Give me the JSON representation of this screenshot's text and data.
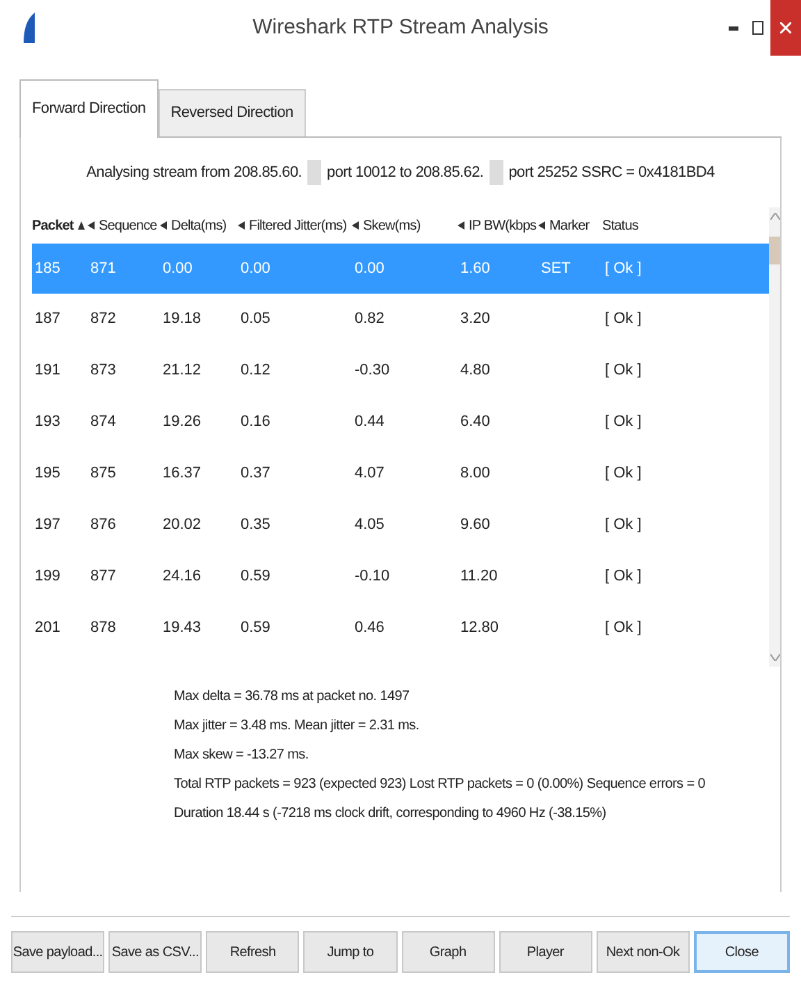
{
  "window": {
    "title": "Wireshark RTP Stream Analysis"
  },
  "tabs": [
    {
      "label": "Forward Direction",
      "selected": true
    },
    {
      "label": "Reversed Direction",
      "selected": false
    }
  ],
  "stream_info": {
    "prefix": "Analysing stream from  208.85.60.",
    "mid": "port 10012  to  208.85.62.",
    "suffix": "port 25252  SSRC = 0x4181BD4"
  },
  "table": {
    "columns": [
      {
        "label": "Packet",
        "sorted": true
      },
      {
        "label": "Sequence",
        "sorted": false
      },
      {
        "label": "Delta(ms)",
        "sorted": false
      },
      {
        "label": "Filtered Jitter(ms)",
        "sorted": false
      },
      {
        "label": "Skew(ms)",
        "sorted": false
      },
      {
        "label": "IP BW(kbps",
        "sorted": false
      },
      {
        "label": "Marker",
        "sorted": false
      },
      {
        "label": "Status",
        "sorted": false
      }
    ],
    "rows": [
      {
        "selected": true,
        "cells": [
          "185",
          "871",
          "0.00",
          "0.00",
          "0.00",
          "1.60",
          "SET",
          "[ Ok ]"
        ]
      },
      {
        "selected": false,
        "cells": [
          "187",
          "872",
          "19.18",
          "0.05",
          "0.82",
          "3.20",
          "",
          "[ Ok ]"
        ]
      },
      {
        "selected": false,
        "cells": [
          "191",
          "873",
          "21.12",
          "0.12",
          "-0.30",
          "4.80",
          "",
          "[ Ok ]"
        ]
      },
      {
        "selected": false,
        "cells": [
          "193",
          "874",
          "19.26",
          "0.16",
          "0.44",
          "6.40",
          "",
          "[ Ok ]"
        ]
      },
      {
        "selected": false,
        "cells": [
          "195",
          "875",
          "16.37",
          "0.37",
          "4.07",
          "8.00",
          "",
          "[ Ok ]"
        ]
      },
      {
        "selected": false,
        "cells": [
          "197",
          "876",
          "20.02",
          "0.35",
          "4.05",
          "9.60",
          "",
          "[ Ok ]"
        ]
      },
      {
        "selected": false,
        "cells": [
          "199",
          "877",
          "24.16",
          "0.59",
          "-0.10",
          "11.20",
          "",
          "[ Ok ]"
        ]
      },
      {
        "selected": false,
        "cells": [
          "201",
          "878",
          "19.43",
          "0.59",
          "0.46",
          "12.80",
          "",
          "[ Ok ]"
        ]
      }
    ]
  },
  "summary": [
    "Max delta = 36.78 ms at packet no. 1497",
    "Max jitter = 3.48 ms. Mean jitter = 2.31 ms.",
    "Max skew = -13.27 ms.",
    "Total RTP packets = 923  (expected 923)  Lost RTP packets = 0 (0.00%)  Sequence errors = 0",
    "Duration 18.44 s (-7218 ms clock drift, corresponding to 4960 Hz (-38.15%)"
  ],
  "buttons": [
    {
      "label": "Save payload...",
      "default": false
    },
    {
      "label": "Save as CSV...",
      "default": false
    },
    {
      "label": "Refresh",
      "default": false
    },
    {
      "label": "Jump to",
      "default": false
    },
    {
      "label": "Graph",
      "default": false
    },
    {
      "label": "Player",
      "default": false
    },
    {
      "label": "Next non-Ok",
      "default": false
    },
    {
      "label": "Close",
      "default": true
    }
  ]
}
